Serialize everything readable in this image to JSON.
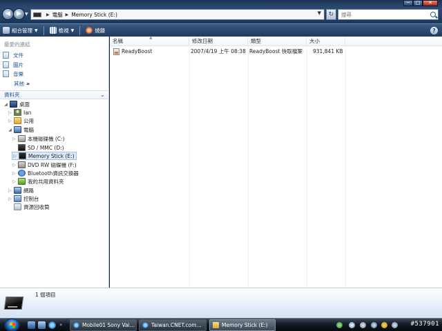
{
  "window": {
    "minimize_glyph": "─",
    "maximize_glyph": "□",
    "close_glyph": "✕"
  },
  "address_bar": {
    "breadcrumbs": [
      "電腦",
      "Memory Stick (E:)"
    ],
    "search_placeholder": "搜尋"
  },
  "toolbar": {
    "organize_label": "組合管理",
    "views_label": "檢視",
    "burn_label": "燒錄",
    "help_glyph": "?"
  },
  "favorites": {
    "header": "最愛的連結",
    "items": [
      {
        "label": "文件",
        "icon": "documents-icon"
      },
      {
        "label": "圖片",
        "icon": "pictures-icon"
      },
      {
        "label": "音樂",
        "icon": "music-icon"
      }
    ],
    "more_label": "其他",
    "more_glyph": "»"
  },
  "folders": {
    "header": "資料夾",
    "tree": [
      {
        "label": "桌面",
        "icon": "desktop-icon",
        "expanded": true
      },
      {
        "label": "Ian",
        "icon": "user-folder-icon",
        "expanded": false
      },
      {
        "label": "公用",
        "icon": "public-folder-icon",
        "expanded": false
      },
      {
        "label": "電腦",
        "icon": "computer-icon",
        "expanded": true
      },
      {
        "label": "本機磁碟機 (C:)",
        "icon": "hard-drive-icon",
        "expanded": false
      },
      {
        "label": "SD / MMC (D:)",
        "icon": "sd-card-icon",
        "expanded": false
      },
      {
        "label": "Memory Stick (E:)",
        "icon": "memory-stick-icon",
        "expanded": false,
        "selected": true
      },
      {
        "label": "DVD RW 磁碟機 (F:)",
        "icon": "dvd-drive-icon",
        "expanded": false
      },
      {
        "label": "Bluetooth資訊交換器",
        "icon": "bluetooth-icon",
        "expanded": false
      },
      {
        "label": "我的共用資料夾",
        "icon": "shared-folder-icon",
        "expanded": false
      },
      {
        "label": "網路",
        "icon": "network-icon",
        "expanded": false
      },
      {
        "label": "控制台",
        "icon": "control-panel-icon",
        "expanded": false
      },
      {
        "label": "資源回收筒",
        "icon": "recycle-bin-icon",
        "expanded": false
      }
    ]
  },
  "file_list": {
    "columns": [
      "名稱",
      "修改日期",
      "類型",
      "大小"
    ],
    "rows": [
      {
        "name": "ReadyBoost",
        "modified": "2007/4/19 上午 08:38",
        "type": "ReadyBoost 快取檔案",
        "size": "931,841 KB"
      }
    ]
  },
  "details_pane": {
    "item_count": "1 個項目"
  },
  "taskbar": {
    "buttons": [
      {
        "label": "Mobile01 Sony Vai...",
        "icon": "ie-icon"
      },
      {
        "label": "Taiwan.CNET.com...",
        "icon": "ie-icon"
      },
      {
        "label": "Memory Stick (E:)",
        "icon": "folder-icon",
        "active": true
      }
    ],
    "watermark": "#537901"
  }
}
